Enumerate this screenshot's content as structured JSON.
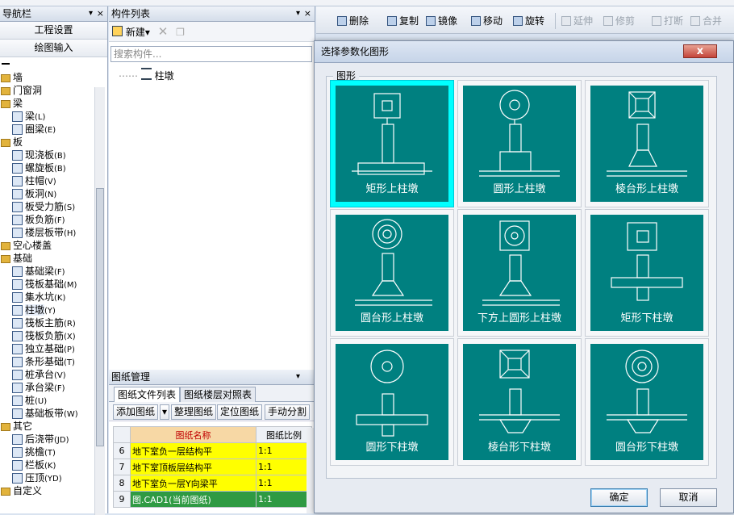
{
  "nav": {
    "title": "导航栏",
    "buttons": [
      "工程设置",
      "绘图输入"
    ],
    "tree": [
      {
        "label": "墙",
        "folder": true
      },
      {
        "label": "门窗洞",
        "folder": true
      },
      {
        "label": "梁",
        "folder": true
      },
      {
        "label": "梁",
        "key": "(L)"
      },
      {
        "label": "圈梁",
        "key": "(E)"
      },
      {
        "label": "板",
        "folder": true
      },
      {
        "label": "现浇板",
        "key": "(B)"
      },
      {
        "label": "螺旋板",
        "key": "(B)"
      },
      {
        "label": "柱帽",
        "key": "(V)"
      },
      {
        "label": "板洞",
        "key": "(N)"
      },
      {
        "label": "板受力筋",
        "key": "(S)"
      },
      {
        "label": "板负筋",
        "key": "(F)"
      },
      {
        "label": "楼层板带",
        "key": "(H)"
      },
      {
        "label": "空心楼盖",
        "folder": true
      },
      {
        "label": "基础",
        "folder": true
      },
      {
        "label": "基础梁",
        "key": "(F)"
      },
      {
        "label": "筏板基础",
        "key": "(M)"
      },
      {
        "label": "集水坑",
        "key": "(K)"
      },
      {
        "label": "柱墩",
        "key": "(Y)",
        "selected": true
      },
      {
        "label": "筏板主筋",
        "key": "(R)"
      },
      {
        "label": "筏板负筋",
        "key": "(X)"
      },
      {
        "label": "独立基础",
        "key": "(P)"
      },
      {
        "label": "条形基础",
        "key": "(T)"
      },
      {
        "label": "桩承台",
        "key": "(V)"
      },
      {
        "label": "承台梁",
        "key": "(F)"
      },
      {
        "label": "桩",
        "key": "(U)"
      },
      {
        "label": "基础板带",
        "key": "(W)"
      },
      {
        "label": "其它",
        "folder": true
      },
      {
        "label": "后浇带",
        "key": "(JD)"
      },
      {
        "label": "挑檐",
        "key": "(T)"
      },
      {
        "label": "栏板",
        "key": "(K)"
      },
      {
        "label": "压顶",
        "key": "(YD)"
      },
      {
        "label": "自定义",
        "folder": true
      }
    ]
  },
  "components": {
    "title": "构件列表",
    "new_label": "新建",
    "search_placeholder": "搜索构件...",
    "node": "柱墩"
  },
  "drawings": {
    "title": "图纸管理",
    "tabs": [
      "图纸文件列表",
      "图纸楼层对照表"
    ],
    "buttons": [
      "添加图纸",
      "整理图纸",
      "定位图纸",
      "手动分割"
    ],
    "headers": [
      "图纸名称",
      "图纸比例"
    ],
    "rows": [
      {
        "no": "6",
        "name": "地下室负一层结构平",
        "scale": "1:1"
      },
      {
        "no": "7",
        "name": "地下室顶板层结构平",
        "scale": "1:1"
      },
      {
        "no": "8",
        "name": "地下室负一层Y向梁平",
        "scale": "1:1"
      },
      {
        "no": "9",
        "name": "图.CAD1(当前图纸)",
        "scale": "1:1",
        "current": true
      }
    ]
  },
  "toolbar": [
    "删除",
    "复制",
    "镜像",
    "移动",
    "旋转",
    "延伸",
    "修剪",
    "打断",
    "合并"
  ],
  "dialog": {
    "title": "选择参数化图形",
    "group": "图形",
    "shapes": [
      {
        "label": "矩形上柱墩",
        "selected": true
      },
      {
        "label": "圆形上柱墩"
      },
      {
        "label": "棱台形上柱墩"
      },
      {
        "label": "圆台形上柱墩"
      },
      {
        "label": "下方上圆形上柱墩"
      },
      {
        "label": "矩形下柱墩"
      },
      {
        "label": "圆形下柱墩"
      },
      {
        "label": "棱台形下柱墩"
      },
      {
        "label": "圆台形下柱墩"
      }
    ],
    "ok": "确定",
    "cancel": "取消",
    "close": "x"
  },
  "colors": {
    "tile_bg": "#008080",
    "selected": "#00ffff",
    "highlight": "#ffff00",
    "current_row": "#2f9a43"
  }
}
